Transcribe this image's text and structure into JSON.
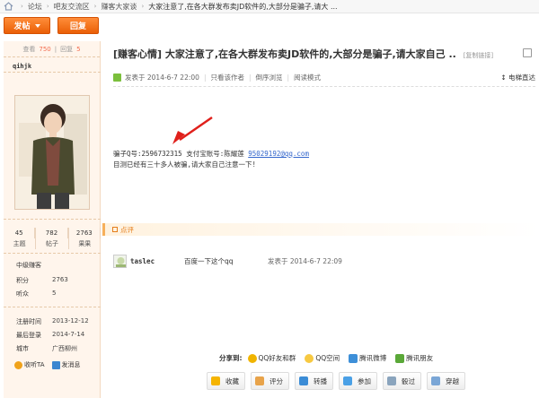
{
  "breadcrumb": {
    "items": [
      "论坛",
      "吧友交流区",
      "赚客大家谈"
    ],
    "title": "大家注意了,在各大群发布卖JD软件的,大部分是骗子,请大 ..."
  },
  "toolbar": {
    "post_label": "发帖",
    "reply_label": "回复",
    "pager": "1"
  },
  "user": {
    "views_label": "查看",
    "views": "750",
    "replies_label": "回复",
    "replies": "5",
    "name": "qihjk",
    "stats": [
      {
        "value": "45",
        "label": "主题"
      },
      {
        "value": "782",
        "label": "帖子"
      },
      {
        "value": "2763",
        "label": "果果"
      }
    ],
    "rank": "中级赚客",
    "fields": [
      {
        "k": "积分",
        "v": "2763"
      },
      {
        "k": "听众",
        "v": "5"
      },
      {
        "k": "注册时间",
        "v": "2013-12-12"
      },
      {
        "k": "最后登录",
        "v": "2014-7-14"
      },
      {
        "k": "城市",
        "v": "广西柳州"
      }
    ],
    "listen_label": "收听TA",
    "message_label": "发消息"
  },
  "post": {
    "title": "[赚客心情] 大家注意了,在各大群发布卖JD软件的,大部分是骗子,请大家自己 ..",
    "copy_link": "[复制链接]",
    "posted": "发表于 2014-6-7 22:00",
    "only_author": "只看该作者",
    "reverse": "倒序浏览",
    "read_mode": "阅读模式",
    "floor": "电梯直达",
    "line1_prefix": "骗子Q号:2596732315 支付宝账号:陈耀莲 ",
    "line1_email": "95029192@qq.com",
    "line2": "目测已经有三十多人被骗,请大家自己注意一下!"
  },
  "comments": {
    "label": "点评",
    "items": [
      {
        "name": "taslec",
        "text": "百度一下这个qq",
        "date": "发表于 2014-6-7 22:09"
      }
    ]
  },
  "share": {
    "label": "分享到:",
    "items": [
      {
        "label": "QQ好友和群",
        "color": "#f0b400"
      },
      {
        "label": "QQ空间",
        "color": "#f7c942"
      },
      {
        "label": "腾讯微博",
        "color": "#3d8fd8"
      },
      {
        "label": "腾讯朋友",
        "color": "#5aa838"
      }
    ]
  },
  "actions": [
    {
      "label": "收藏",
      "color": "#f5b400"
    },
    {
      "label": "评分",
      "color": "#e8a34a"
    },
    {
      "label": "转播",
      "color": "#3b8cd6"
    },
    {
      "label": "参加",
      "color": "#4aa0e6"
    },
    {
      "label": "骰过",
      "color": "#8aa4bd"
    },
    {
      "label": "穿越",
      "color": "#7aa6d6"
    }
  ],
  "colors": {
    "accent": "#ea5f06",
    "link": "#3366cc",
    "sidebar_bg": "#fff5ec"
  }
}
